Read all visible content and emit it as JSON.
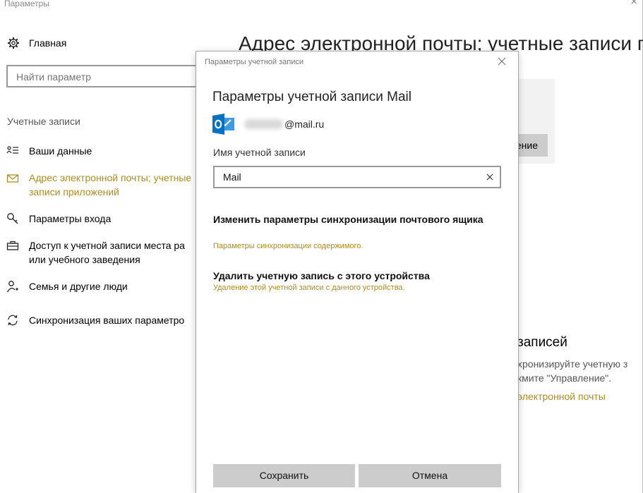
{
  "window": {
    "title": "Параметры"
  },
  "sidebar": {
    "home_label": "Главная",
    "search_placeholder": "Найти параметр",
    "section_label": "Учетные записи",
    "items": [
      {
        "label": "Ваши данные",
        "icon": "person-card-icon"
      },
      {
        "label": "Адрес электронной почты; учетные",
        "label2": "записи приложений",
        "icon": "mail-icon",
        "active": true
      },
      {
        "label": "Параметры входа",
        "icon": "key-icon"
      },
      {
        "label": "Доступ к учетной записи места ра",
        "label2": "или учебного заведения",
        "icon": "briefcase-icon"
      },
      {
        "label": "Семья и другие люди",
        "icon": "person-add-icon"
      },
      {
        "label": "Синхронизация ваших параметро",
        "icon": "sync-icon"
      }
    ]
  },
  "main": {
    "heading": "Адрес электронной почты; учетные записи пр",
    "manage_button_fragment": "ление",
    "subheading_fragment": "записей",
    "paragraph_line1": "хронизируйте учетную з",
    "paragraph_line2": "кмите \"Управление\".",
    "link_fragment": "электронной почты"
  },
  "dialog": {
    "title": "Параметры учетной записи",
    "heading": "Параметры учетной записи Mail",
    "account_email_suffix": "@mail.ru",
    "account_name_label": "Имя учетной записи",
    "account_name_value": "Mail",
    "sync_option_title": "Изменить параметры синхронизации почтового ящика",
    "sync_option_sub": "Параметры синхронизации содержимого.",
    "delete_option_title": "Удалить учетную запись с этого устройства",
    "delete_option_sub": "Удаление этой учетной записи с данного устройства.",
    "save_label": "Сохранить",
    "cancel_label": "Отмена"
  },
  "colors": {
    "accent": "#b28a1f",
    "button": "#cccccc",
    "outlook_blue": "#0072c6"
  }
}
